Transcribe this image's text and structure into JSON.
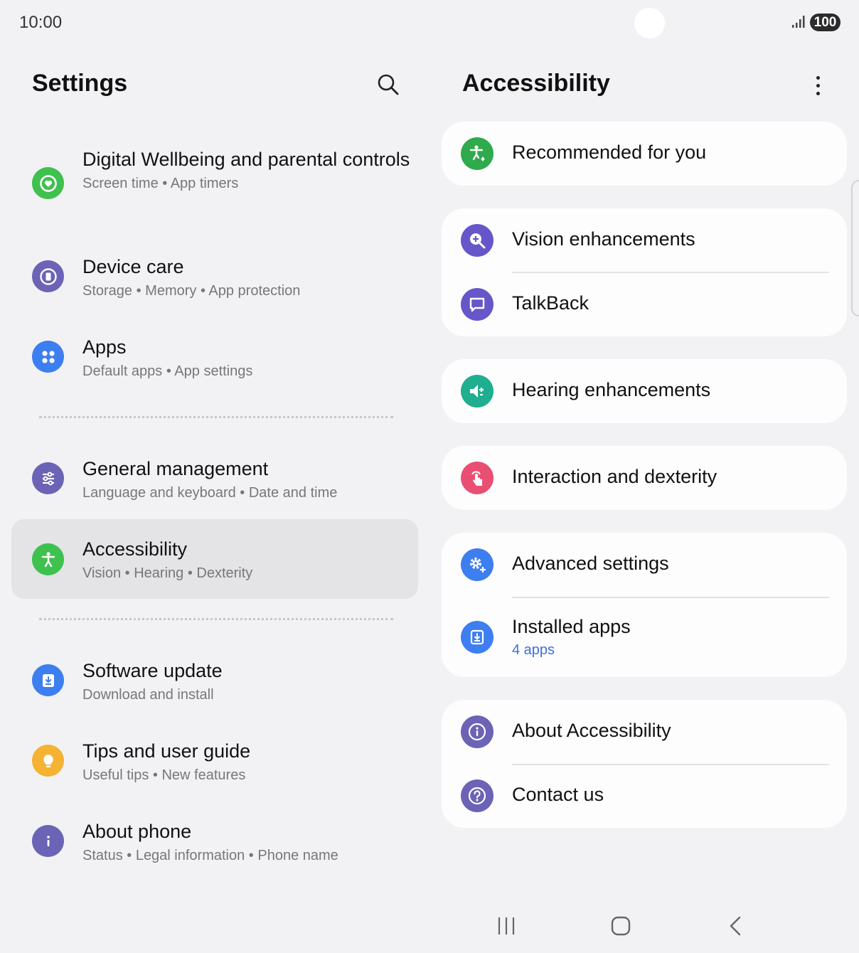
{
  "status_bar": {
    "time": "10:00",
    "battery": "100"
  },
  "left_pane": {
    "title": "Settings",
    "items": [
      {
        "title": "Digital Wellbeing and parental controls",
        "subtitle": "Screen time  •  App timers",
        "icon": "digital-wellbeing-icon",
        "color": "#3ec14e"
      },
      {
        "title": "Device care",
        "subtitle": "Storage  •  Memory  •  App protection",
        "icon": "device-care-icon",
        "color": "#6b63b5"
      },
      {
        "title": "Apps",
        "subtitle": "Default apps  •  App settings",
        "icon": "apps-icon",
        "color": "#3d7ef0"
      },
      {
        "title": "General management",
        "subtitle": "Language and keyboard  •  Date and time",
        "icon": "general-management-icon",
        "color": "#6b63b5"
      },
      {
        "title": "Accessibility",
        "subtitle": "Vision  •  Hearing  •  Dexterity",
        "icon": "accessibility-icon",
        "color": "#3ec14e",
        "selected": true
      },
      {
        "title": "Software update",
        "subtitle": "Download and install",
        "icon": "software-update-icon",
        "color": "#3d7ef0"
      },
      {
        "title": "Tips and user guide",
        "subtitle": "Useful tips  •  New features",
        "icon": "tips-icon",
        "color": "#f6b233"
      },
      {
        "title": "About phone",
        "subtitle": "Status  •  Legal information  •  Phone name",
        "icon": "about-phone-icon",
        "color": "#6b63b5"
      }
    ]
  },
  "right_pane": {
    "title": "Accessibility",
    "rows": {
      "recommended": {
        "label": "Recommended for you",
        "icon": "recommended-accessibility-icon",
        "color": "#2faa4c"
      },
      "vision": {
        "label": "Vision enhancements",
        "icon": "vision-magnifier-icon",
        "color": "#6656c9"
      },
      "talkback": {
        "label": "TalkBack",
        "icon": "talkback-chat-icon",
        "color": "#6656c9"
      },
      "hearing": {
        "label": "Hearing enhancements",
        "icon": "hearing-speaker-icon",
        "color": "#1fae8f"
      },
      "interaction": {
        "label": "Interaction and dexterity",
        "icon": "interaction-touch-icon",
        "color": "#e84f73"
      },
      "advanced": {
        "label": "Advanced settings",
        "icon": "advanced-gear-icon",
        "color": "#3d7ef0"
      },
      "installed": {
        "label": "Installed apps",
        "sub": "4 apps",
        "icon": "installed-download-icon",
        "color": "#3d7ef0"
      },
      "about": {
        "label": "About Accessibility",
        "icon": "info-icon",
        "color": "#6b63b5"
      },
      "contact": {
        "label": "Contact us",
        "icon": "help-question-icon",
        "color": "#6b63b5"
      }
    }
  }
}
